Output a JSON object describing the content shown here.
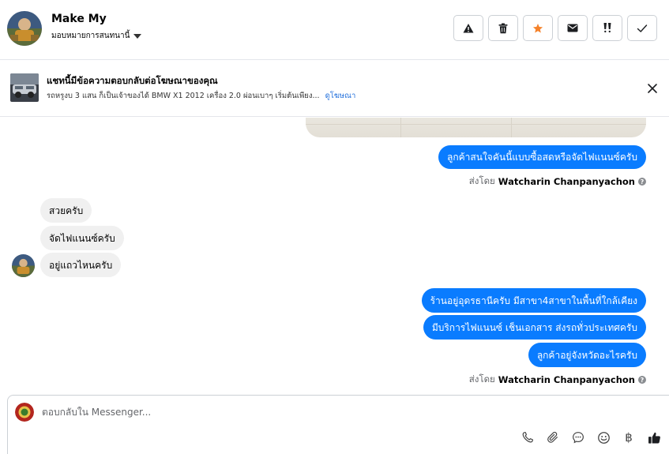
{
  "header": {
    "contact_name": "Make My",
    "assign_label": "มอบหมายการสนทนานี้",
    "actions": [
      {
        "name": "spam-button",
        "icon": "warning-icon"
      },
      {
        "name": "delete-button",
        "icon": "trash-icon"
      },
      {
        "name": "star-button",
        "icon": "star-icon"
      },
      {
        "name": "mark-unread-button",
        "icon": "envelope-icon"
      },
      {
        "name": "follow-up-button",
        "icon": "exclamation-icon"
      },
      {
        "name": "mark-done-button",
        "icon": "check-icon"
      }
    ],
    "colors": {
      "star": "#f5822a",
      "dark_icon": "#1c1e21"
    }
  },
  "ad": {
    "title": "แชทนี้มีข้อความตอบกลับต่อโฆษณาของคุณ",
    "description": "รถหรูงบ 3 แสน ก็เป็นเจ้าของได้ BMW X1 2012 เครื่อง 2.0 ผ่อนเบาๆ เริ่มต้นเพียง...",
    "link": "ดูโฆษณา"
  },
  "messages": {
    "out_1": "ลูกค้าสนใจคันนี้แบบซื้อสดหรือจัดไฟแนนซ์ครับ",
    "sent_by_1": {
      "prefix": "ส่งโดย",
      "name": "Watcharin Chanpanyachon"
    },
    "in_1": "สวยครับ",
    "in_2": "จัดไฟแนนซ์ครับ",
    "in_3": "อยู่แถวไหนครับ",
    "out_2": "ร้านอยู่อุดรธานีครับ มีสาขา4สาขาในพื้นที่ใกล้เคียง",
    "out_3": "มีบริการไฟแนนซ์ เช็นเอกสาร ส่งรถทั่วประเทศครับ",
    "out_4": "ลูกค้าอยู่จังหวัดอะไรครับ",
    "sent_by_2": {
      "prefix": "ส่งโดย",
      "name": "Watcharin Chanpanyachon"
    },
    "info_symbol": "?"
  },
  "composer": {
    "placeholder": "ตอบกลับใน Messenger...",
    "tools": [
      "phone-icon",
      "paperclip-icon",
      "chat-bubble-icon",
      "emoji-icon",
      "baht-icon",
      "thumbs-up-icon"
    ],
    "baht_symbol": "฿"
  },
  "colors": {
    "outgoing_bubble": "#0a7cff",
    "incoming_bubble": "#f0f0f0",
    "link": "#216fdb"
  }
}
